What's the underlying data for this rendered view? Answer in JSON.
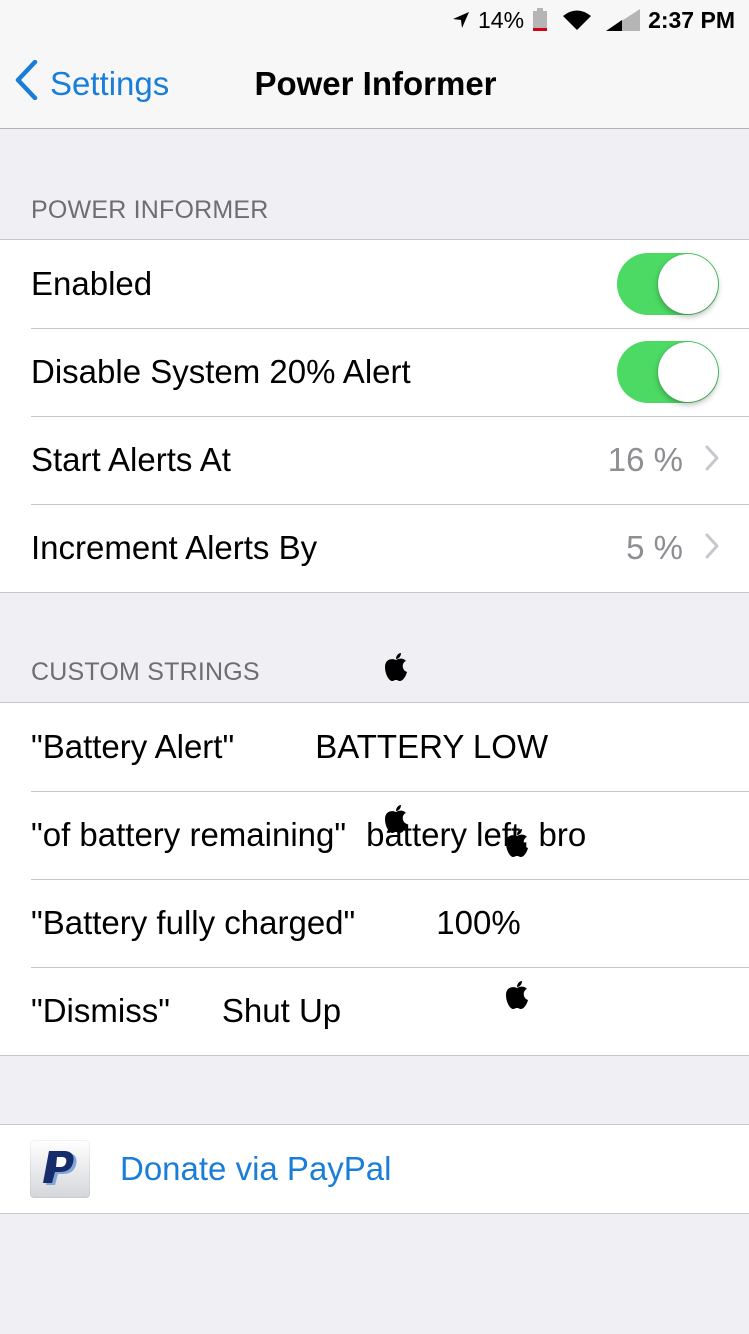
{
  "status_bar": {
    "location_icon": "location-arrow-icon",
    "battery_percent": "14%",
    "battery_icon": "battery-low-icon",
    "wifi_icon": "wifi-icon",
    "signal_icon": "cellular-signal-icon",
    "time": "2:37 PM"
  },
  "nav": {
    "back_label": "Settings",
    "back_icon": "chevron-left-icon",
    "title": "Power Informer"
  },
  "sections": {
    "power_informer": {
      "header": "POWER INFORMER",
      "rows": [
        {
          "label": "Enabled",
          "type": "toggle",
          "on": true
        },
        {
          "label": "Disable System 20% Alert",
          "type": "toggle",
          "on": true
        },
        {
          "label": "Start Alerts At",
          "type": "disclosure",
          "value": "16 %"
        },
        {
          "label": "Increment Alerts By",
          "type": "disclosure",
          "value": "5 %"
        }
      ]
    },
    "custom_strings": {
      "header": "CUSTOM STRINGS",
      "rows": [
        {
          "label": "\"Battery Alert\"",
          "value_parts": [
            "apple-logo-icon",
            " BATTERY LOW ",
            "apple-logo-icon"
          ]
        },
        {
          "label": "\"of battery remaining\"",
          "value": "battery left, bro"
        },
        {
          "label": "\"Battery fully charged\"",
          "value_parts": [
            "apple-logo-icon",
            " 100% ",
            "apple-logo-icon"
          ]
        },
        {
          "label": "\"Dismiss\"",
          "value": "Shut Up"
        }
      ],
      "battery_low_text": "BATTERY LOW",
      "fully_charged_text": "100%"
    },
    "donate": {
      "icon": "paypal-icon",
      "label": "Donate via PayPal"
    }
  },
  "colors": {
    "accent": "#1a7ed8",
    "toggle_on": "#4cd964",
    "background": "#efeff4",
    "battery_low": "#d0021b"
  }
}
